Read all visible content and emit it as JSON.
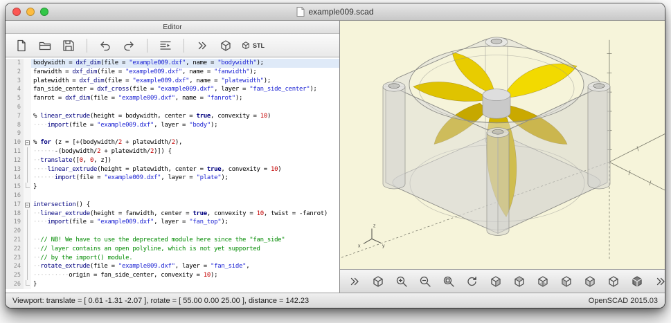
{
  "window": {
    "title": "example009.scad"
  },
  "titlebar": {
    "traffic_lights": [
      {
        "name": "close-button",
        "color": "#fc5753"
      },
      {
        "name": "minimize-button",
        "color": "#fdbc40"
      },
      {
        "name": "zoom-button",
        "color": "#33c748"
      }
    ]
  },
  "editor": {
    "panel_title": "Editor",
    "toolbar": [
      {
        "name": "new-button",
        "icon": "new-file"
      },
      {
        "name": "open-button",
        "icon": "open-folder"
      },
      {
        "name": "save-button",
        "icon": "save"
      },
      {
        "sep": true
      },
      {
        "name": "undo-button",
        "icon": "undo"
      },
      {
        "name": "redo-button",
        "icon": "redo"
      },
      {
        "sep": true
      },
      {
        "name": "indent-button",
        "icon": "indent"
      },
      {
        "sep": true
      },
      {
        "name": "preview-button",
        "icon": "preview"
      },
      {
        "name": "render-button",
        "icon": "render"
      },
      {
        "name": "export-stl-button",
        "icon": "stl",
        "label": "STL"
      }
    ],
    "active_line": 1,
    "lines": [
      {
        "n": 1,
        "fold": null,
        "segs": [
          [
            "v",
            "bodywidth"
          ],
          [
            "o",
            " = "
          ],
          [
            "f",
            "dxf_dim"
          ],
          [
            "o",
            "("
          ],
          [
            "v",
            "file"
          ],
          [
            "o",
            " = "
          ],
          [
            "s",
            "\"example009.dxf\""
          ],
          [
            "o",
            ", "
          ],
          [
            "v",
            "name"
          ],
          [
            "o",
            " = "
          ],
          [
            "s",
            "\"bodywidth\""
          ],
          [
            "o",
            ");"
          ]
        ]
      },
      {
        "n": 2,
        "fold": null,
        "segs": [
          [
            "v",
            "fanwidth"
          ],
          [
            "o",
            " = "
          ],
          [
            "f",
            "dxf_dim"
          ],
          [
            "o",
            "("
          ],
          [
            "v",
            "file"
          ],
          [
            "o",
            " = "
          ],
          [
            "s",
            "\"example009.dxf\""
          ],
          [
            "o",
            ", "
          ],
          [
            "v",
            "name"
          ],
          [
            "o",
            " = "
          ],
          [
            "s",
            "\"fanwidth\""
          ],
          [
            "o",
            ");"
          ]
        ]
      },
      {
        "n": 3,
        "fold": null,
        "segs": [
          [
            "v",
            "platewidth"
          ],
          [
            "o",
            " = "
          ],
          [
            "f",
            "dxf_dim"
          ],
          [
            "o",
            "("
          ],
          [
            "v",
            "file"
          ],
          [
            "o",
            " = "
          ],
          [
            "s",
            "\"example009.dxf\""
          ],
          [
            "o",
            ", "
          ],
          [
            "v",
            "name"
          ],
          [
            "o",
            " = "
          ],
          [
            "s",
            "\"platewidth\""
          ],
          [
            "o",
            ");"
          ]
        ]
      },
      {
        "n": 4,
        "fold": null,
        "segs": [
          [
            "v",
            "fan_side_center"
          ],
          [
            "o",
            " = "
          ],
          [
            "f",
            "dxf_cross"
          ],
          [
            "o",
            "("
          ],
          [
            "v",
            "file"
          ],
          [
            "o",
            " = "
          ],
          [
            "s",
            "\"example009.dxf\""
          ],
          [
            "o",
            ", "
          ],
          [
            "v",
            "layer"
          ],
          [
            "o",
            " = "
          ],
          [
            "s",
            "\"fan_side_center\""
          ],
          [
            "o",
            ");"
          ]
        ]
      },
      {
        "n": 5,
        "fold": null,
        "segs": [
          [
            "v",
            "fanrot"
          ],
          [
            "o",
            " = "
          ],
          [
            "f",
            "dxf_dim"
          ],
          [
            "o",
            "("
          ],
          [
            "v",
            "file"
          ],
          [
            "o",
            " = "
          ],
          [
            "s",
            "\"example009.dxf\""
          ],
          [
            "o",
            ", "
          ],
          [
            "v",
            "name"
          ],
          [
            "o",
            " = "
          ],
          [
            "s",
            "\"fanrot\""
          ],
          [
            "o",
            ");"
          ]
        ]
      },
      {
        "n": 6,
        "fold": null,
        "segs": []
      },
      {
        "n": 7,
        "fold": null,
        "segs": [
          [
            "m",
            "% "
          ],
          [
            "f",
            "linear_extrude"
          ],
          [
            "o",
            "("
          ],
          [
            "v",
            "height"
          ],
          [
            "o",
            " = "
          ],
          [
            "v",
            "bodywidth"
          ],
          [
            "o",
            ", "
          ],
          [
            "v",
            "center"
          ],
          [
            "o",
            " = "
          ],
          [
            "k",
            "true"
          ],
          [
            "o",
            ", "
          ],
          [
            "v",
            "convexity"
          ],
          [
            "o",
            " = "
          ],
          [
            "n",
            "10"
          ],
          [
            "o",
            ")"
          ]
        ]
      },
      {
        "n": 8,
        "fold": null,
        "segs": [
          [
            "w",
            "····"
          ],
          [
            "f",
            "import"
          ],
          [
            "o",
            "("
          ],
          [
            "v",
            "file"
          ],
          [
            "o",
            " = "
          ],
          [
            "s",
            "\"example009.dxf\""
          ],
          [
            "o",
            ", "
          ],
          [
            "v",
            "layer"
          ],
          [
            "o",
            " = "
          ],
          [
            "s",
            "\"body\""
          ],
          [
            "o",
            ");"
          ]
        ]
      },
      {
        "n": 9,
        "fold": null,
        "segs": []
      },
      {
        "n": 10,
        "fold": "open",
        "segs": [
          [
            "m",
            "% "
          ],
          [
            "k",
            "for"
          ],
          [
            "o",
            " ("
          ],
          [
            "v",
            "z"
          ],
          [
            "o",
            " = [+("
          ],
          [
            "v",
            "bodywidth"
          ],
          [
            "o",
            "/"
          ],
          [
            "n",
            "2"
          ],
          [
            "o",
            " + "
          ],
          [
            "v",
            "platewidth"
          ],
          [
            "o",
            "/"
          ],
          [
            "n",
            "2"
          ],
          [
            "o",
            "),"
          ]
        ]
      },
      {
        "n": 11,
        "fold": "mid",
        "segs": [
          [
            "w",
            "······"
          ],
          [
            "o",
            "-("
          ],
          [
            "v",
            "bodywidth"
          ],
          [
            "o",
            "/"
          ],
          [
            "n",
            "2"
          ],
          [
            "o",
            " + "
          ],
          [
            "v",
            "platewidth"
          ],
          [
            "o",
            "/"
          ],
          [
            "n",
            "2"
          ],
          [
            "o",
            ")]) {"
          ]
        ]
      },
      {
        "n": 12,
        "fold": "mid",
        "segs": [
          [
            "w",
            "··"
          ],
          [
            "f",
            "translate"
          ],
          [
            "o",
            "(["
          ],
          [
            "n",
            "0"
          ],
          [
            "o",
            ", "
          ],
          [
            "n",
            "0"
          ],
          [
            "o",
            ", "
          ],
          [
            "v",
            "z"
          ],
          [
            "o",
            "])"
          ]
        ]
      },
      {
        "n": 13,
        "fold": "mid",
        "segs": [
          [
            "w",
            "····"
          ],
          [
            "f",
            "linear_extrude"
          ],
          [
            "o",
            "("
          ],
          [
            "v",
            "height"
          ],
          [
            "o",
            " = "
          ],
          [
            "v",
            "platewidth"
          ],
          [
            "o",
            ", "
          ],
          [
            "v",
            "center"
          ],
          [
            "o",
            " = "
          ],
          [
            "k",
            "true"
          ],
          [
            "o",
            ", "
          ],
          [
            "v",
            "convexity"
          ],
          [
            "o",
            " = "
          ],
          [
            "n",
            "10"
          ],
          [
            "o",
            ")"
          ]
        ]
      },
      {
        "n": 14,
        "fold": "mid",
        "segs": [
          [
            "w",
            "······"
          ],
          [
            "f",
            "import"
          ],
          [
            "o",
            "("
          ],
          [
            "v",
            "file"
          ],
          [
            "o",
            " = "
          ],
          [
            "s",
            "\"example009.dxf\""
          ],
          [
            "o",
            ", "
          ],
          [
            "v",
            "layer"
          ],
          [
            "o",
            " = "
          ],
          [
            "s",
            "\"plate\""
          ],
          [
            "o",
            ");"
          ]
        ]
      },
      {
        "n": 15,
        "fold": "end",
        "segs": [
          [
            "o",
            "}"
          ]
        ]
      },
      {
        "n": 16,
        "fold": null,
        "segs": []
      },
      {
        "n": 17,
        "fold": "open",
        "segs": [
          [
            "f",
            "intersection"
          ],
          [
            "o",
            "() {"
          ]
        ]
      },
      {
        "n": 18,
        "fold": "mid",
        "segs": [
          [
            "w",
            "··"
          ],
          [
            "f",
            "linear_extrude"
          ],
          [
            "o",
            "("
          ],
          [
            "v",
            "height"
          ],
          [
            "o",
            " = "
          ],
          [
            "v",
            "fanwidth"
          ],
          [
            "o",
            ", "
          ],
          [
            "v",
            "center"
          ],
          [
            "o",
            " = "
          ],
          [
            "k",
            "true"
          ],
          [
            "o",
            ", "
          ],
          [
            "v",
            "convexity"
          ],
          [
            "o",
            " = "
          ],
          [
            "n",
            "10"
          ],
          [
            "o",
            ", "
          ],
          [
            "v",
            "twist"
          ],
          [
            "o",
            " = -"
          ],
          [
            "v",
            "fanrot"
          ],
          [
            "o",
            ")"
          ]
        ]
      },
      {
        "n": 19,
        "fold": "mid",
        "segs": [
          [
            "w",
            "····"
          ],
          [
            "f",
            "import"
          ],
          [
            "o",
            "("
          ],
          [
            "v",
            "file"
          ],
          [
            "o",
            " = "
          ],
          [
            "s",
            "\"example009.dxf\""
          ],
          [
            "o",
            ", "
          ],
          [
            "v",
            "layer"
          ],
          [
            "o",
            " = "
          ],
          [
            "s",
            "\"fan_top\""
          ],
          [
            "o",
            ");"
          ]
        ]
      },
      {
        "n": 20,
        "fold": "mid",
        "segs": []
      },
      {
        "n": 21,
        "fold": "mid",
        "segs": [
          [
            "w",
            "··"
          ],
          [
            "c",
            "// NB! We have to use the deprecated module here since the \"fan_side\""
          ]
        ]
      },
      {
        "n": 22,
        "fold": "mid",
        "segs": [
          [
            "w",
            "··"
          ],
          [
            "c",
            "// layer contains an open polyline, which is not yet supported"
          ]
        ]
      },
      {
        "n": 23,
        "fold": "mid",
        "segs": [
          [
            "w",
            "··"
          ],
          [
            "c",
            "// by the import() module."
          ]
        ]
      },
      {
        "n": 24,
        "fold": "mid",
        "segs": [
          [
            "w",
            "··"
          ],
          [
            "f",
            "rotate_extrude"
          ],
          [
            "o",
            "("
          ],
          [
            "v",
            "file"
          ],
          [
            "o",
            " = "
          ],
          [
            "s",
            "\"example009.dxf\""
          ],
          [
            "o",
            ", "
          ],
          [
            "v",
            "layer"
          ],
          [
            "o",
            " = "
          ],
          [
            "s",
            "\"fan_side\""
          ],
          [
            "o",
            ","
          ]
        ]
      },
      {
        "n": 25,
        "fold": "mid",
        "segs": [
          [
            "w",
            "··········"
          ],
          [
            "v",
            "origin"
          ],
          [
            "o",
            " = "
          ],
          [
            "v",
            "fan_side_center"
          ],
          [
            "o",
            ", "
          ],
          [
            "v",
            "convexity"
          ],
          [
            "o",
            " = "
          ],
          [
            "n",
            "10"
          ],
          [
            "o",
            ");"
          ]
        ]
      },
      {
        "n": 26,
        "fold": "end",
        "segs": [
          [
            "o",
            "}"
          ]
        ]
      }
    ]
  },
  "viewport": {
    "background": "#f6f4da",
    "axis_labels": {
      "x": "x",
      "y": "y",
      "z": "z"
    },
    "model_colors": {
      "fan": "#e3c400",
      "housing": "#d8d8d8"
    },
    "toolbar": [
      {
        "name": "view-more-left-button",
        "icon": "chevrons"
      },
      {
        "name": "view-render-button",
        "icon": "render"
      },
      {
        "name": "zoom-in-button",
        "icon": "zoom-in"
      },
      {
        "name": "zoom-out-button",
        "icon": "zoom-out"
      },
      {
        "name": "zoom-all-button",
        "icon": "zoom-all"
      },
      {
        "name": "reset-view-button",
        "icon": "reset-view"
      },
      {
        "name": "view-right-button",
        "icon": "view-right"
      },
      {
        "name": "view-top-button",
        "icon": "view-top"
      },
      {
        "name": "view-bottom-button",
        "icon": "view-bottom"
      },
      {
        "name": "view-left-button",
        "icon": "view-left"
      },
      {
        "name": "view-front-button",
        "icon": "view-front"
      },
      {
        "name": "view-back-button",
        "icon": "view-back"
      },
      {
        "name": "perspective-button",
        "icon": "perspective"
      },
      {
        "name": "view-more-right-button",
        "icon": "chevrons",
        "push": true
      }
    ]
  },
  "statusbar": {
    "left": "Viewport: translate = [ 0.61 -1.31 -2.07 ], rotate = [ 55.00 0.00 25.00 ], distance = 142.23",
    "right": "OpenSCAD 2015.03"
  }
}
